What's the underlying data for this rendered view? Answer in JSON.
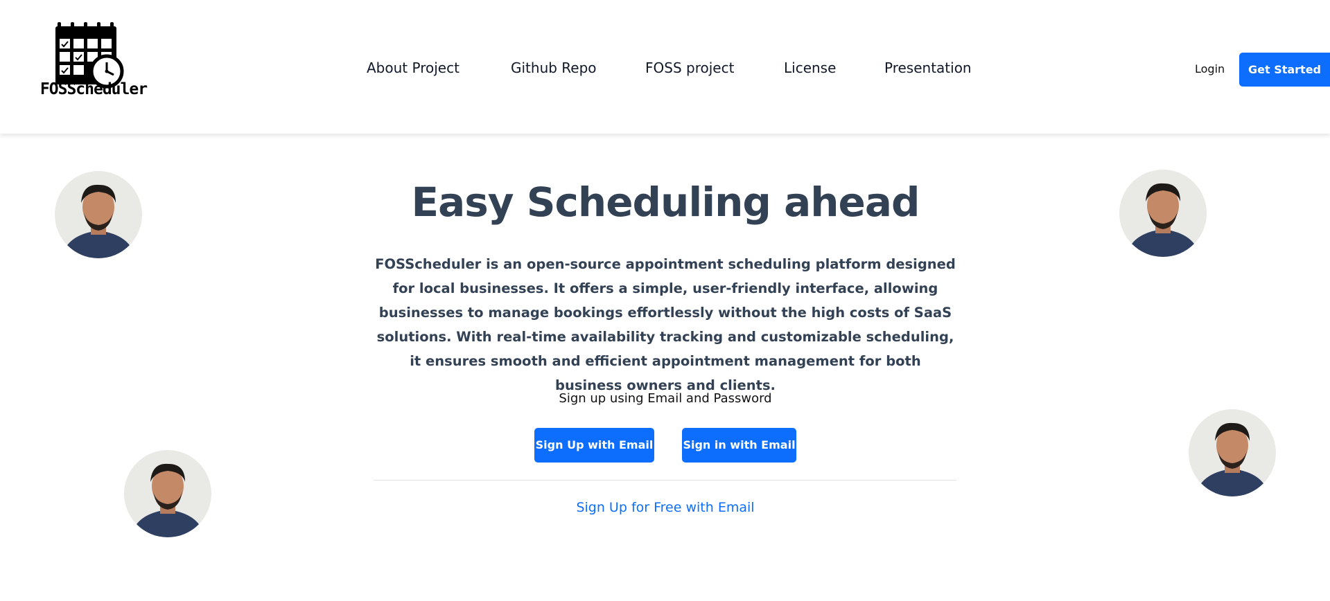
{
  "brand": {
    "name": "FOSScheduler",
    "logo_text": "FOSScheduler"
  },
  "nav": {
    "items": [
      {
        "label": "About Project"
      },
      {
        "label": "Github Repo"
      },
      {
        "label": "FOSS project"
      },
      {
        "label": "License"
      },
      {
        "label": "Presentation"
      }
    ],
    "login_label": "Login",
    "get_started_label": "Get Started"
  },
  "hero": {
    "title": "Easy Scheduling ahead",
    "description": "FOSScheduler is an open-source appointment scheduling platform designed for local businesses. It offers a simple, user-friendly interface, allowing businesses to manage bookings effortlessly without the high costs of SaaS solutions. With real-time availability tracking and customizable scheduling, it ensures smooth and efficient appointment management for both business owners and clients.",
    "signup_hint": "Sign up using Email and Password",
    "signup_button": "Sign Up with Email",
    "signin_button": "Sign in with Email",
    "free_signup_link": "Sign Up for Free with Email"
  },
  "colors": {
    "accent": "#0d6efd",
    "heading": "#334155",
    "background": "#ffffff"
  },
  "icons": {
    "logo": "calendar-clock-icon",
    "avatar": "user-avatar"
  }
}
